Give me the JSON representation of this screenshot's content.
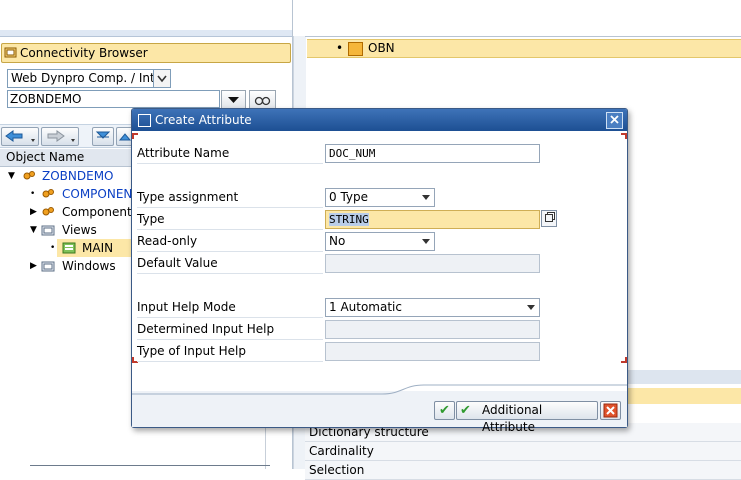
{
  "left": {
    "connectivity_label": "Connectivity Browser",
    "object_type": "Web Dynpro Comp. / Intf.",
    "object_name": "ZOBNDEMO",
    "tree_header": "Object Name",
    "tree": [
      {
        "label": "ZOBNDEMO",
        "link": true
      },
      {
        "label": "COMPONENT",
        "link": true
      },
      {
        "label": "Component",
        "link": false
      },
      {
        "label": "Views",
        "link": false
      },
      {
        "label": "MAIN",
        "link": false
      },
      {
        "label": "Windows",
        "link": false
      }
    ]
  },
  "right": {
    "obn_label": "OBN",
    "properties": [
      "Dictionary structure",
      "Cardinality",
      "Selection"
    ]
  },
  "dialog": {
    "title": "Create Attribute",
    "fields": {
      "attribute_name": {
        "label": "Attribute Name",
        "value": "DOC_NUM"
      },
      "type_assignment": {
        "label": "Type assignment",
        "value": "0 Type"
      },
      "type": {
        "label": "Type",
        "value": "STRING"
      },
      "read_only": {
        "label": "Read-only",
        "value": "No"
      },
      "default_value": {
        "label": "Default Value",
        "value": ""
      },
      "input_help_mode": {
        "label": "Input Help Mode",
        "value": "1 Automatic"
      },
      "determined_input_help": {
        "label": "Determined Input Help",
        "value": ""
      },
      "type_of_input_help": {
        "label": "Type of Input Help",
        "value": ""
      }
    },
    "buttons": {
      "additional_attribute": "Additional Attribute"
    }
  },
  "colors": {
    "title_bar": "#1d4f93",
    "highlight": "#fce7a7",
    "link": "#0a3fc4"
  }
}
